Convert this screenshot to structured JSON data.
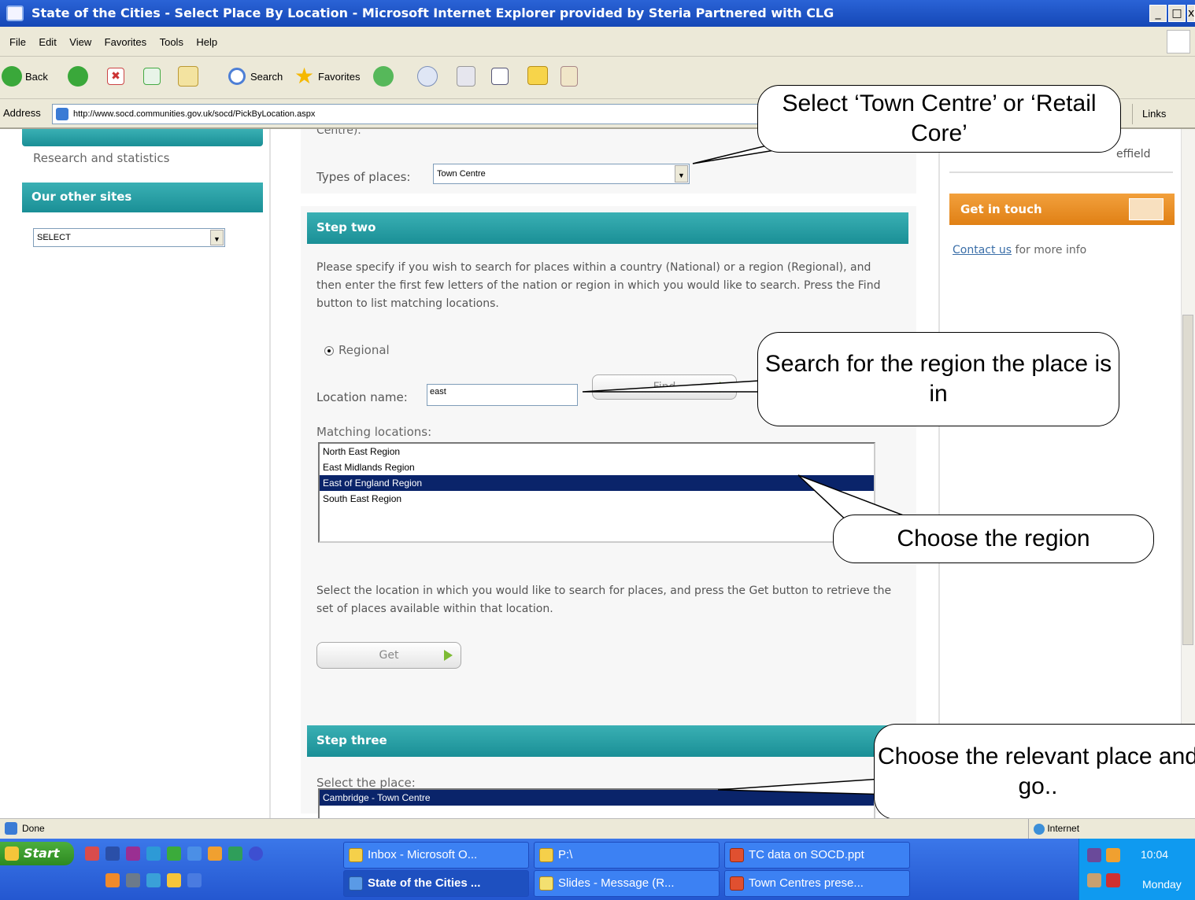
{
  "window": {
    "title": "State of the Cities - Select Place By Location - Microsoft Internet Explorer provided by Steria Partnered with CLG",
    "controls": [
      "_",
      "□",
      "x"
    ]
  },
  "menu": [
    "File",
    "Edit",
    "View",
    "Favorites",
    "Tools",
    "Help"
  ],
  "toolbar": {
    "back": "Back",
    "search": "Search",
    "favorites": "Favorites"
  },
  "address": {
    "label": "Address",
    "url": "http://www.socd.communities.gov.uk/socd/PickByLocation.aspx",
    "links": "Links"
  },
  "left_sidebar": {
    "research_link": "Research and statistics",
    "other_sites_header": "Our other sites",
    "other_sites_select": "SELECT"
  },
  "step_one": {
    "clipped_text": "Centre).",
    "types_label": "Types of places:",
    "types_value": "Town Centre"
  },
  "step_two": {
    "header": "Step two",
    "instructions": "Please specify if you wish to search for places within a country (National) or a region (Regional), and then enter the first few letters of the nation or region in which you would like to search. Press the Find button to list matching locations.",
    "radio_label": "Regional",
    "location_label": "Location name:",
    "location_value": "east",
    "find_button": "Find",
    "matching_label": "Matching locations:",
    "matching_items": [
      "North East Region",
      "East Midlands Region",
      "East of England Region",
      "South East Region"
    ],
    "selected_item": "East of England Region",
    "get_instructions": "Select the location in which you would like to search for places, and press the Get button to retrieve the set of places available within that location.",
    "get_button": "Get"
  },
  "step_three": {
    "header": "Step three",
    "select_label": "Select the place:",
    "place_selected": "Cambridge - Town Centre"
  },
  "right_sidebar": {
    "clipped_text": "effield",
    "get_in_touch": "Get in touch",
    "contact_link": "Contact us",
    "contact_suffix": "for more info"
  },
  "callouts": {
    "types": "Select ‘Town Centre’ or ‘Retail Core’",
    "search": "Search for the region the place is in",
    "choose_region": "Choose the region",
    "choose_place": "Choose the relevant place and go.."
  },
  "status": {
    "text": "Done",
    "zone": "Internet"
  },
  "taskbar": {
    "start": "Start",
    "tasks_top": [
      "Inbox - Microsoft O...",
      "P:\\",
      "TC data on SOCD.ppt"
    ],
    "tasks_bottom": [
      "State of the Cities ...",
      "Slides - Message (R...",
      "Town Centres prese..."
    ],
    "time": "10:04",
    "day": "Monday"
  },
  "colors": {
    "teal": "#1a8f96",
    "orange": "#e88a1a",
    "title_blue": "#1547b6",
    "selection": "#0a246a"
  }
}
